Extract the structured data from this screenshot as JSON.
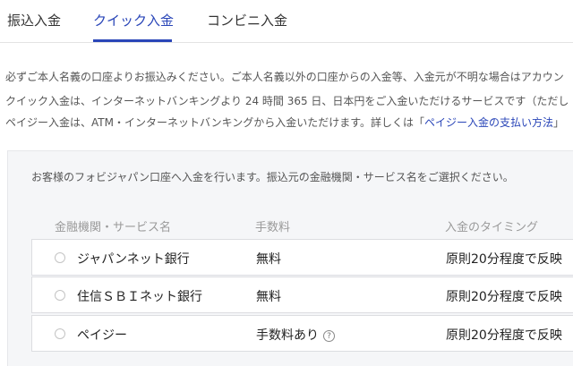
{
  "tabs": {
    "items": [
      {
        "label": "振込入金"
      },
      {
        "label": "クイック入金"
      },
      {
        "label": "コンビニ入金"
      }
    ],
    "active": "クイック入金"
  },
  "notices": {
    "line1": "必ずご本人名義の口座よりお振込みください。ご本人名義以外の口座からの入金等、入金元が不明な場合はアカウン",
    "line2": "クイック入金は、インターネットバンキングより 24 時間 365 日、日本円をご入金いただけるサービスです（ただし",
    "line3_prefix": "ペイジー入金は、ATM・インターネットバンキングから入金いただけます。詳しくは「",
    "line3_link": "ペイジー入金の支払い方法",
    "line3_suffix": "」"
  },
  "panel": {
    "description": "お客様のフォビジャパン口座へ入金を行います。振込元の金融機関・サービス名をご選択ください。",
    "headers": {
      "name": "金融機関・サービス名",
      "fee": "手数料",
      "timing": "入金のタイミング"
    },
    "rows": [
      {
        "name": "ジャパンネット銀行",
        "fee": "無料",
        "timing": "原則20分程度で反映"
      },
      {
        "name": "住信ＳＢＩネット銀行",
        "fee": "無料",
        "timing": "原則20分程度で反映"
      },
      {
        "name": "ペイジー",
        "fee": "手数料あり",
        "help": "?",
        "timing": "原則20分程度で反映"
      }
    ]
  },
  "colors": {
    "accent": "#2a46b8",
    "panel_bg": "#f5f6f8"
  }
}
